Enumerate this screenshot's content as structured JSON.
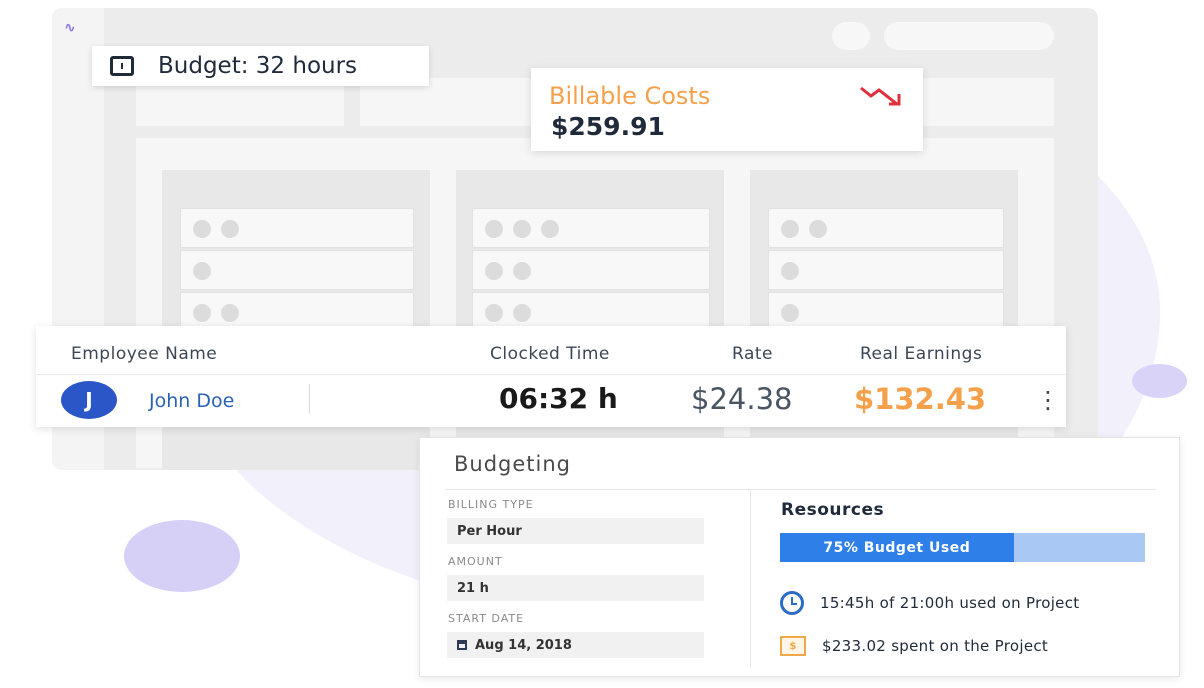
{
  "budget_badge": {
    "text": "Budget: 32 hours"
  },
  "billable": {
    "label": "Billable Costs",
    "value": "$259.91",
    "trend_icon": "trending-down-icon",
    "trend_color": "#e0303a"
  },
  "employee_table": {
    "headers": [
      "Employee Name",
      "Clocked Time",
      "Rate",
      "Real Earnings"
    ],
    "row": {
      "avatar_initial": "J",
      "name": "John Doe",
      "clocked_time": "06:32 h",
      "rate": "$24.38",
      "real_earnings": "$132.43"
    }
  },
  "budgeting": {
    "title": "Budgeting",
    "fields": [
      {
        "label": "BILLING TYPE",
        "value": "Per Hour"
      },
      {
        "label": "AMOUNT",
        "value": "21 h"
      },
      {
        "label": "START DATE",
        "value": "Aug 14, 2018"
      }
    ],
    "resources": {
      "title": "Resources",
      "progress_label": "75% Budget Used",
      "progress_fraction": 0.64,
      "time_used": "15:45h of 21:00h used on Project",
      "money_spent": "$233.02 spent on the Project"
    }
  },
  "colors": {
    "accent_orange": "#f5a04a",
    "primary_blue": "#2b56c8",
    "progress_blue": "#2f7fe8"
  }
}
